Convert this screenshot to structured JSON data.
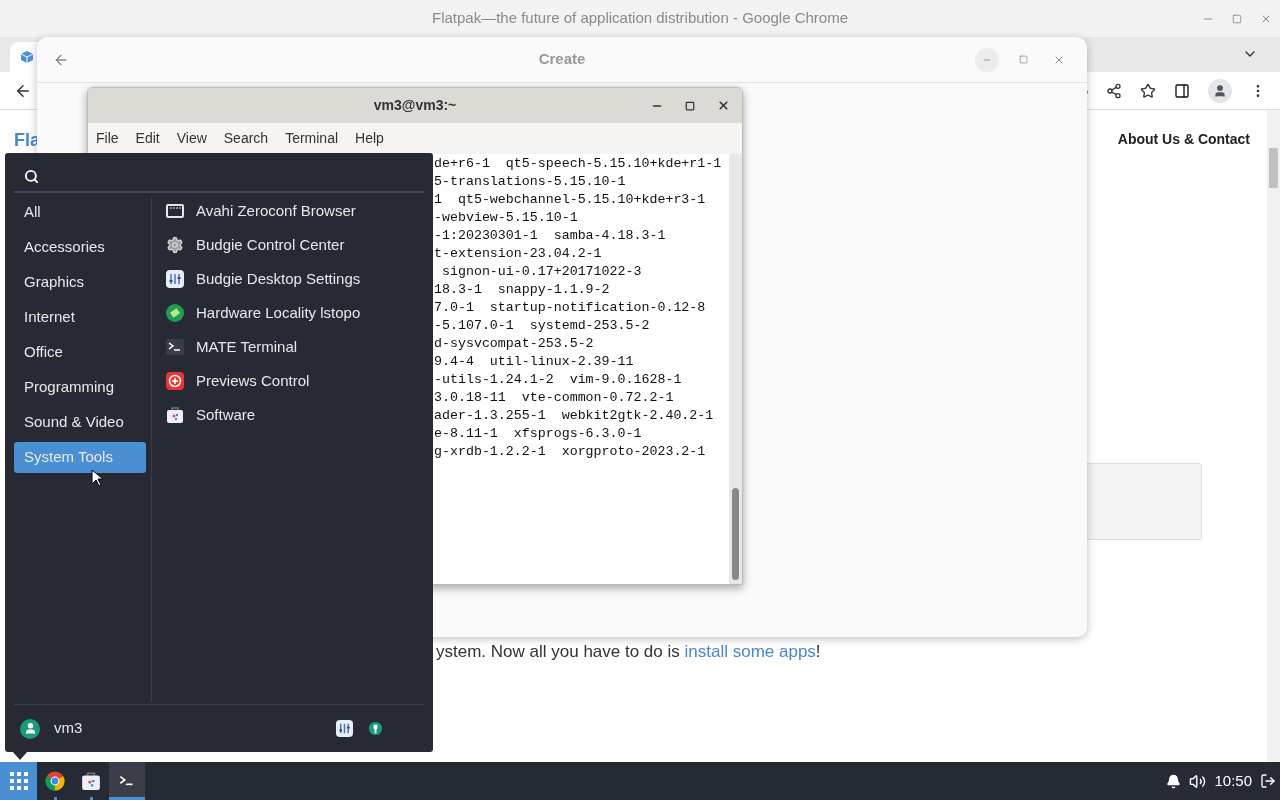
{
  "browser": {
    "title": "Flatpak—the future of application distribution - Google Chrome",
    "site_logo_text": "Fla",
    "nav_link": "About Us & Contact",
    "body_text": "ystem. Now all you have to do is ",
    "body_link": "install some apps",
    "body_end": "!"
  },
  "dialog": {
    "title": "Create"
  },
  "terminal": {
    "title": "vm3@vm3:~",
    "menus": [
      "File",
      "Edit",
      "View",
      "Search",
      "Terminal",
      "Help"
    ],
    "lines": [
      "de+r6-1  qt5-speech-5.15.10+kde+r1-1",
      "5-translations-5.15.10-1",
      "1  qt5-webchannel-5.15.10+kde+r3-1",
      "-webview-5.15.10-1",
      "-1:20230301-1  samba-4.18.3-1",
      "t-extension-23.04.2-1",
      " signon-ui-0.17+20171022-3",
      "18.3-1  snappy-1.1.9-2",
      "7.0-1  startup-notification-0.12-8",
      "-5.107.0-1  systemd-253.5-2",
      "d-sysvcompat-253.5-2",
      "9.4-4  util-linux-2.39-11",
      "-utils-1.24.1-2  vim-9.0.1628-1",
      "3.0.18-11  vte-common-0.72.2-1",
      "ader-1.3.255-1  webkit2gtk-2.40.2-1",
      "e-8.11-1  xfsprogs-6.3.0-1",
      "g-xrdb-1.2.2-1  xorgproto-2023.2-1"
    ]
  },
  "menu": {
    "categories": [
      {
        "label": "All",
        "selected": false
      },
      {
        "label": "Accessories",
        "selected": false
      },
      {
        "label": "Graphics",
        "selected": false
      },
      {
        "label": "Internet",
        "selected": false
      },
      {
        "label": "Office",
        "selected": false
      },
      {
        "label": "Programming",
        "selected": false
      },
      {
        "label": "Sound & Video",
        "selected": false
      },
      {
        "label": "System Tools",
        "selected": true
      }
    ],
    "apps": [
      {
        "label": "Avahi Zeroconf Browser",
        "kind": "network"
      },
      {
        "label": "Budgie Control Center",
        "kind": "gear"
      },
      {
        "label": "Budgie Desktop Settings",
        "kind": "sliders"
      },
      {
        "label": "Hardware Locality lstopo",
        "kind": "chip"
      },
      {
        "label": "MATE Terminal",
        "kind": "terminal"
      },
      {
        "label": "Previews Control",
        "kind": "previews"
      },
      {
        "label": "Software",
        "kind": "software"
      }
    ],
    "user": "vm3"
  },
  "taskbar": {
    "apps": [
      {
        "kind": "chrome",
        "running": true,
        "active": false
      },
      {
        "kind": "software",
        "running": true,
        "active": false
      },
      {
        "kind": "terminal",
        "running": true,
        "active": true
      }
    ],
    "clock": "10:50"
  }
}
